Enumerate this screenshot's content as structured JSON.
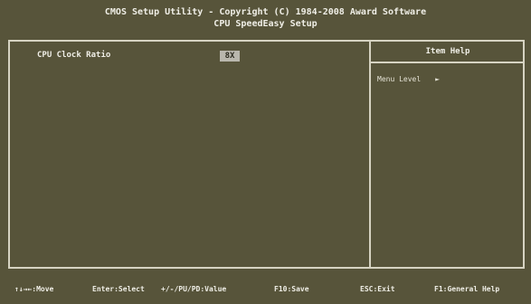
{
  "header": {
    "line1": "CMOS Setup Utility - Copyright (C) 1984-2008 Award Software",
    "line2": "CPU SpeedEasy Setup"
  },
  "settings": [
    {
      "label": "CPU Clock Ratio",
      "value": "8X"
    }
  ],
  "help": {
    "title": "Item Help",
    "menu_level_label": "Menu Level",
    "menu_level_arrow": "►"
  },
  "footer": {
    "move": "↑↓→←:Move",
    "enter": "Enter:Select",
    "value": "+/-/PU/PD:Value",
    "save": "F10:Save",
    "exit": "ESC:Exit",
    "general_help": "F1:General Help"
  },
  "colors": {
    "background": "#57543a",
    "text": "#efeee6",
    "border": "#d6d3c2",
    "highlight": "#b9b7ad"
  }
}
